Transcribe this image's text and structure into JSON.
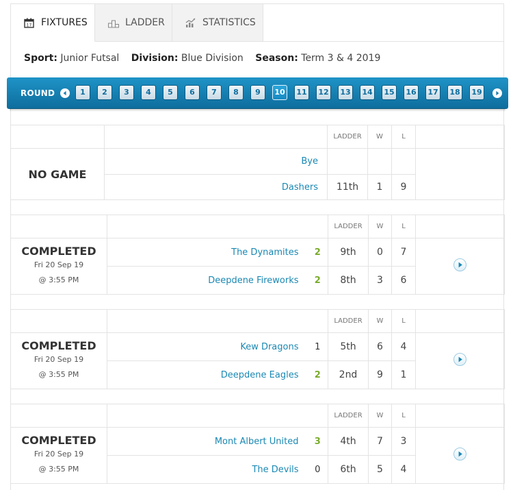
{
  "tabs": [
    {
      "label": "FIXTURES",
      "icon": "calendar-icon"
    },
    {
      "label": "LADDER",
      "icon": "podium-icon"
    },
    {
      "label": "STATISTICS",
      "icon": "chart-icon"
    }
  ],
  "meta": {
    "sport_label": "Sport:",
    "sport": "Junior Futsal",
    "division_label": "Division:",
    "division": "Blue Division",
    "season_label": "Season:",
    "season": "Term 3 & 4 2019"
  },
  "rounds": {
    "label": "ROUND",
    "numbers": [
      "1",
      "2",
      "3",
      "4",
      "5",
      "6",
      "7",
      "8",
      "9",
      "10",
      "11",
      "12",
      "13",
      "14",
      "15",
      "16",
      "17",
      "18",
      "19"
    ],
    "current": "10"
  },
  "headers": {
    "ladder": "LADDER",
    "w": "W",
    "l": "L"
  },
  "bye": {
    "status": "NO GAME",
    "rows": [
      {
        "team": "Bye",
        "ladder": "",
        "w": "",
        "l": ""
      },
      {
        "team": "Dashers",
        "ladder": "11th",
        "w": "1",
        "l": "9"
      }
    ]
  },
  "matches": [
    {
      "status": "COMPLETED",
      "date": "Fri 20 Sep 19",
      "time": "@ 3:55 PM",
      "teams": [
        {
          "name": "The Dynamites",
          "score": "2",
          "ladder": "9th",
          "w": "0",
          "l": "7",
          "win": true
        },
        {
          "name": "Deepdene Fireworks",
          "score": "2",
          "ladder": "8th",
          "w": "3",
          "l": "6",
          "win": true
        }
      ]
    },
    {
      "status": "COMPLETED",
      "date": "Fri 20 Sep 19",
      "time": "@ 3:55 PM",
      "teams": [
        {
          "name": "Kew Dragons",
          "score": "1",
          "ladder": "5th",
          "w": "6",
          "l": "4",
          "win": false
        },
        {
          "name": "Deepdene Eagles",
          "score": "2",
          "ladder": "2nd",
          "w": "9",
          "l": "1",
          "win": true
        }
      ]
    },
    {
      "status": "COMPLETED",
      "date": "Fri 20 Sep 19",
      "time": "@ 3:55 PM",
      "teams": [
        {
          "name": "Mont Albert United",
          "score": "3",
          "ladder": "4th",
          "w": "7",
          "l": "3",
          "win": true
        },
        {
          "name": "The Devils",
          "score": "0",
          "ladder": "6th",
          "w": "5",
          "l": "4",
          "win": false
        }
      ]
    }
  ]
}
